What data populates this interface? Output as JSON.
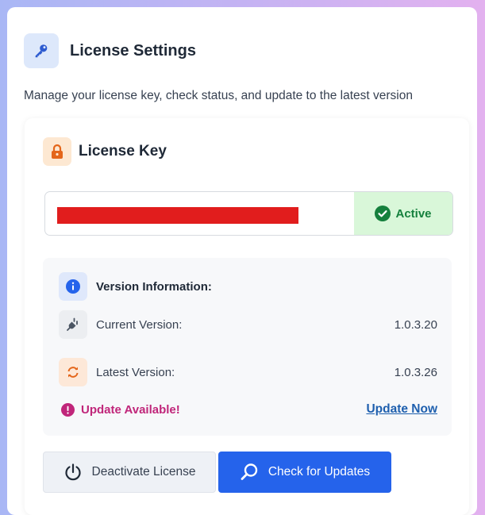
{
  "header": {
    "title": "License Settings",
    "icon": "key-icon"
  },
  "subtitle": "Manage your license key, check status, and update to the latest version",
  "license_card": {
    "title": "License Key",
    "icon": "lock-icon",
    "key_value": "",
    "status": {
      "label": "Active",
      "color": "#15803d",
      "background": "#d9f7d9"
    }
  },
  "version_info": {
    "heading": "Version Information:",
    "current": {
      "label": "Current Version:",
      "value": "1.0.3.20"
    },
    "latest": {
      "label": "Latest Version:",
      "value": "1.0.3.26"
    },
    "update_notice": "Update Available!",
    "update_link": "Update Now"
  },
  "buttons": {
    "deactivate": "Deactivate License",
    "check_updates": "Check for Updates"
  },
  "colors": {
    "primary": "#2563eb",
    "alert": "#c0267a",
    "link": "#1e5fae"
  }
}
